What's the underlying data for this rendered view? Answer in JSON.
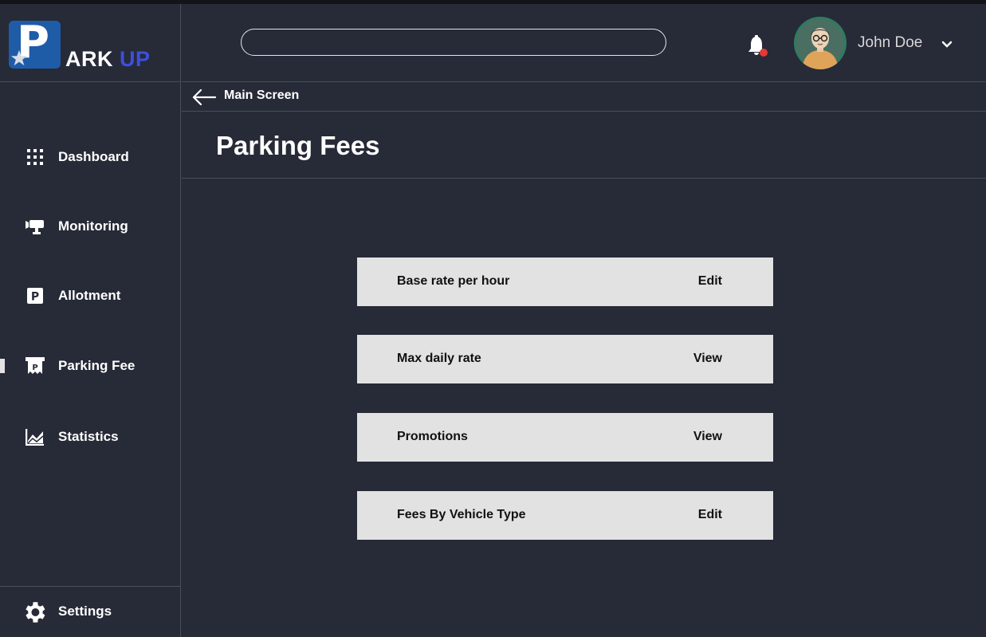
{
  "app": {
    "logo_letter": "P",
    "name_part1": "ARK",
    "name_part2": " UP"
  },
  "sidebar": {
    "items": [
      {
        "label": "Dashboard",
        "icon": "grid-icon"
      },
      {
        "label": "Monitoring",
        "icon": "camera-icon"
      },
      {
        "label": "Allotment",
        "icon": "parking-p-icon"
      },
      {
        "label": "Parking Fee",
        "icon": "parking-ticket-icon",
        "active": true
      },
      {
        "label": "Statistics",
        "icon": "chart-area-icon"
      }
    ],
    "settings_label": "Settings"
  },
  "header": {
    "search_value": "",
    "search_placeholder": "",
    "user_name": "John Doe",
    "notification_color": "#e53935"
  },
  "breadcrumb": {
    "back_label": "Main Screen"
  },
  "page": {
    "title": "Parking Fees"
  },
  "fees": [
    {
      "label": "Base rate per hour",
      "action": "Edit"
    },
    {
      "label": "Max daily rate",
      "action": "View"
    },
    {
      "label": "Promotions",
      "action": "View"
    },
    {
      "label": "Fees By Vehicle Type",
      "action": "Edit"
    }
  ],
  "colors": {
    "background": "#272a37",
    "accent": "#3b50e0",
    "logo_bg": "#1f5ca8",
    "row_bg": "#e2e2e2"
  }
}
